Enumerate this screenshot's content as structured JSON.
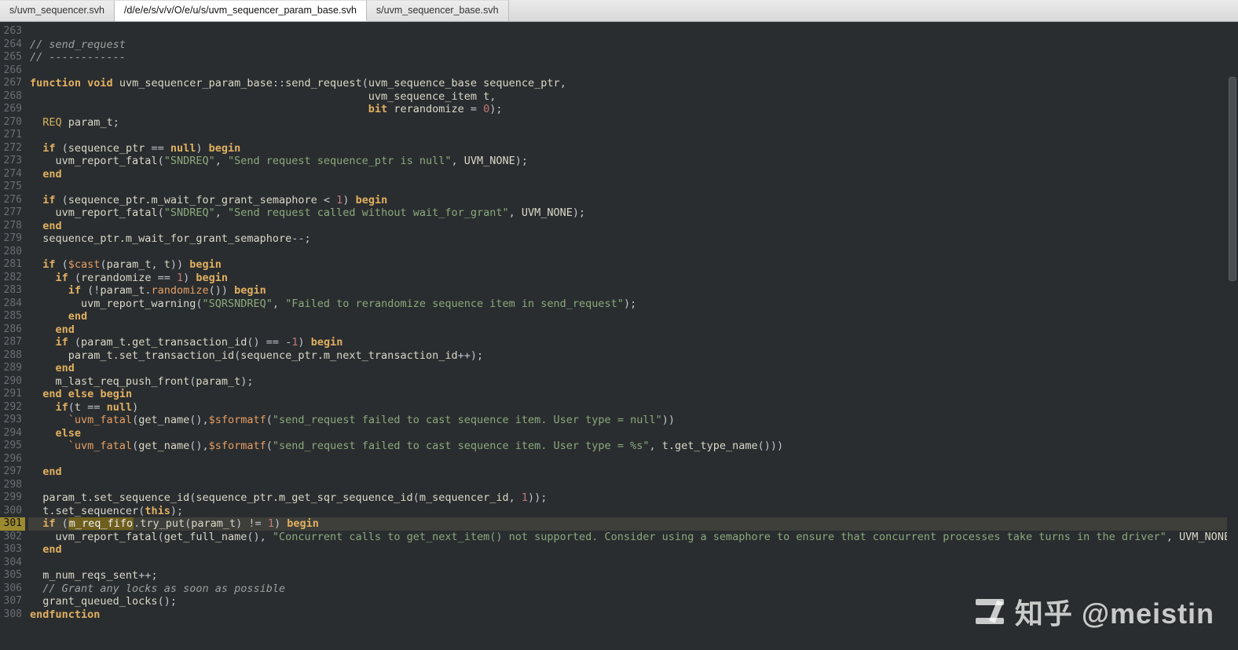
{
  "tabs": [
    {
      "label": "s/uvm_sequencer.svh",
      "active": false
    },
    {
      "label": "/d/e/e/s/v/v/O/e/u/s/uvm_sequencer_param_base.svh",
      "active": true
    },
    {
      "label": "s/uvm_sequencer_base.svh",
      "active": false
    }
  ],
  "first_line_number": 263,
  "highlighted_line": 301,
  "watermark": "知乎 @meistin",
  "lines": [
    {
      "n": 263,
      "t": []
    },
    {
      "n": 264,
      "t": [
        [
          "cm",
          "// send_request"
        ]
      ]
    },
    {
      "n": 265,
      "t": [
        [
          "cm",
          "// ------------"
        ]
      ]
    },
    {
      "n": 266,
      "t": []
    },
    {
      "n": 267,
      "t": [
        [
          "kw",
          "function void"
        ],
        [
          "op",
          " "
        ],
        [
          "fn",
          "uvm_sequencer_param_base"
        ],
        [
          "op",
          "::"
        ],
        [
          "fn",
          "send_request"
        ],
        [
          "op",
          "("
        ],
        [
          "fn",
          "uvm_sequence_base sequence_ptr"
        ],
        [
          "op",
          ","
        ]
      ]
    },
    {
      "n": 268,
      "t": [
        [
          "op",
          "                                                     "
        ],
        [
          "fn",
          "uvm_sequence_item t"
        ],
        [
          "op",
          ","
        ]
      ]
    },
    {
      "n": 269,
      "t": [
        [
          "op",
          "                                                     "
        ],
        [
          "kw",
          "bit"
        ],
        [
          "op",
          " "
        ],
        [
          "fn",
          "rerandomize"
        ],
        [
          "op",
          " = "
        ],
        [
          "nu",
          "0"
        ],
        [
          "op",
          ");"
        ]
      ]
    },
    {
      "n": 270,
      "t": [
        [
          "op",
          "  "
        ],
        [
          "ty",
          "REQ"
        ],
        [
          "op",
          " "
        ],
        [
          "fn",
          "param_t"
        ],
        [
          "op",
          ";"
        ]
      ]
    },
    {
      "n": 271,
      "t": []
    },
    {
      "n": 272,
      "t": [
        [
          "op",
          "  "
        ],
        [
          "kw",
          "if"
        ],
        [
          "op",
          " ("
        ],
        [
          "fn",
          "sequence_ptr"
        ],
        [
          "op",
          " == "
        ],
        [
          "kw",
          "null"
        ],
        [
          "op",
          ") "
        ],
        [
          "kw",
          "begin"
        ]
      ]
    },
    {
      "n": 273,
      "t": [
        [
          "op",
          "    "
        ],
        [
          "fn",
          "uvm_report_fatal"
        ],
        [
          "op",
          "("
        ],
        [
          "st",
          "\"SNDREQ\""
        ],
        [
          "op",
          ", "
        ],
        [
          "st",
          "\"Send request sequence_ptr is null\""
        ],
        [
          "op",
          ", "
        ],
        [
          "fn",
          "UVM_NONE"
        ],
        [
          "op",
          ");"
        ]
      ]
    },
    {
      "n": 274,
      "t": [
        [
          "op",
          "  "
        ],
        [
          "kw",
          "end"
        ]
      ]
    },
    {
      "n": 275,
      "t": []
    },
    {
      "n": 276,
      "t": [
        [
          "op",
          "  "
        ],
        [
          "kw",
          "if"
        ],
        [
          "op",
          " ("
        ],
        [
          "fn",
          "sequence_ptr.m_wait_for_grant_semaphore"
        ],
        [
          "op",
          " < "
        ],
        [
          "nu",
          "1"
        ],
        [
          "op",
          ") "
        ],
        [
          "kw",
          "begin"
        ]
      ]
    },
    {
      "n": 277,
      "t": [
        [
          "op",
          "    "
        ],
        [
          "fn",
          "uvm_report_fatal"
        ],
        [
          "op",
          "("
        ],
        [
          "st",
          "\"SNDREQ\""
        ],
        [
          "op",
          ", "
        ],
        [
          "st",
          "\"Send request called without wait_for_grant\""
        ],
        [
          "op",
          ", "
        ],
        [
          "fn",
          "UVM_NONE"
        ],
        [
          "op",
          ");"
        ]
      ]
    },
    {
      "n": 278,
      "t": [
        [
          "op",
          "  "
        ],
        [
          "kw",
          "end"
        ]
      ]
    },
    {
      "n": 279,
      "t": [
        [
          "op",
          "  "
        ],
        [
          "fn",
          "sequence_ptr.m_wait_for_grant_semaphore"
        ],
        [
          "op",
          "--;"
        ]
      ]
    },
    {
      "n": 280,
      "t": []
    },
    {
      "n": 281,
      "t": [
        [
          "op",
          "  "
        ],
        [
          "kw",
          "if"
        ],
        [
          "op",
          " ("
        ],
        [
          "mc",
          "$cast"
        ],
        [
          "op",
          "("
        ],
        [
          "fn",
          "param_t"
        ],
        [
          "op",
          ", "
        ],
        [
          "fn",
          "t"
        ],
        [
          "op",
          ")) "
        ],
        [
          "kw",
          "begin"
        ]
      ]
    },
    {
      "n": 282,
      "t": [
        [
          "op",
          "    "
        ],
        [
          "kw",
          "if"
        ],
        [
          "op",
          " ("
        ],
        [
          "fn",
          "rerandomize"
        ],
        [
          "op",
          " == "
        ],
        [
          "nu",
          "1"
        ],
        [
          "op",
          ") "
        ],
        [
          "kw",
          "begin"
        ]
      ]
    },
    {
      "n": 283,
      "t": [
        [
          "op",
          "      "
        ],
        [
          "kw",
          "if"
        ],
        [
          "op",
          " (!"
        ],
        [
          "fn",
          "param_t"
        ],
        [
          "op",
          "."
        ],
        [
          "mc",
          "randomize"
        ],
        [
          "op",
          "()) "
        ],
        [
          "kw",
          "begin"
        ]
      ]
    },
    {
      "n": 284,
      "t": [
        [
          "op",
          "        "
        ],
        [
          "fn",
          "uvm_report_warning"
        ],
        [
          "op",
          "("
        ],
        [
          "st",
          "\"SQRSNDREQ\""
        ],
        [
          "op",
          ", "
        ],
        [
          "st",
          "\"Failed to rerandomize sequence item in send_request\""
        ],
        [
          "op",
          ");"
        ]
      ]
    },
    {
      "n": 285,
      "t": [
        [
          "op",
          "      "
        ],
        [
          "kw",
          "end"
        ]
      ]
    },
    {
      "n": 286,
      "t": [
        [
          "op",
          "    "
        ],
        [
          "kw",
          "end"
        ]
      ]
    },
    {
      "n": 287,
      "t": [
        [
          "op",
          "    "
        ],
        [
          "kw",
          "if"
        ],
        [
          "op",
          " ("
        ],
        [
          "fn",
          "param_t.get_transaction_id"
        ],
        [
          "op",
          "() == -"
        ],
        [
          "nu",
          "1"
        ],
        [
          "op",
          ") "
        ],
        [
          "kw",
          "begin"
        ]
      ]
    },
    {
      "n": 288,
      "t": [
        [
          "op",
          "      "
        ],
        [
          "fn",
          "param_t.set_transaction_id"
        ],
        [
          "op",
          "("
        ],
        [
          "fn",
          "sequence_ptr.m_next_transaction_id"
        ],
        [
          "op",
          "++);"
        ]
      ]
    },
    {
      "n": 289,
      "t": [
        [
          "op",
          "    "
        ],
        [
          "kw",
          "end"
        ]
      ]
    },
    {
      "n": 290,
      "t": [
        [
          "op",
          "    "
        ],
        [
          "fn",
          "m_last_req_push_front"
        ],
        [
          "op",
          "("
        ],
        [
          "fn",
          "param_t"
        ],
        [
          "op",
          ");"
        ]
      ]
    },
    {
      "n": 291,
      "t": [
        [
          "op",
          "  "
        ],
        [
          "kw",
          "end"
        ],
        [
          "op",
          " "
        ],
        [
          "kw",
          "else"
        ],
        [
          "op",
          " "
        ],
        [
          "kw",
          "begin"
        ]
      ]
    },
    {
      "n": 292,
      "t": [
        [
          "op",
          "    "
        ],
        [
          "kw",
          "if"
        ],
        [
          "op",
          "("
        ],
        [
          "fn",
          "t"
        ],
        [
          "op",
          " == "
        ],
        [
          "kw",
          "null"
        ],
        [
          "op",
          ")"
        ]
      ]
    },
    {
      "n": 293,
      "t": [
        [
          "op",
          "      "
        ],
        [
          "mc",
          "`uvm_fatal"
        ],
        [
          "op",
          "("
        ],
        [
          "fn",
          "get_name"
        ],
        [
          "op",
          "(),"
        ],
        [
          "mc",
          "$sformatf"
        ],
        [
          "op",
          "("
        ],
        [
          "st",
          "\"send_request failed to cast sequence item. User type = null\""
        ],
        [
          "op",
          "))"
        ]
      ]
    },
    {
      "n": 294,
      "t": [
        [
          "op",
          "    "
        ],
        [
          "kw",
          "else"
        ]
      ]
    },
    {
      "n": 295,
      "t": [
        [
          "op",
          "      "
        ],
        [
          "mc",
          "`uvm_fatal"
        ],
        [
          "op",
          "("
        ],
        [
          "fn",
          "get_name"
        ],
        [
          "op",
          "(),"
        ],
        [
          "mc",
          "$sformatf"
        ],
        [
          "op",
          "("
        ],
        [
          "st",
          "\"send_request failed to cast sequence item. User type = %s\""
        ],
        [
          "op",
          ", "
        ],
        [
          "fn",
          "t.get_type_name"
        ],
        [
          "op",
          "()))"
        ]
      ]
    },
    {
      "n": 296,
      "t": []
    },
    {
      "n": 297,
      "t": [
        [
          "op",
          "  "
        ],
        [
          "kw",
          "end"
        ]
      ]
    },
    {
      "n": 298,
      "t": []
    },
    {
      "n": 299,
      "t": [
        [
          "op",
          "  "
        ],
        [
          "fn",
          "param_t.set_sequence_id"
        ],
        [
          "op",
          "("
        ],
        [
          "fn",
          "sequence_ptr.m_get_sqr_sequence_id"
        ],
        [
          "op",
          "("
        ],
        [
          "fn",
          "m_sequencer_id"
        ],
        [
          "op",
          ", "
        ],
        [
          "nu",
          "1"
        ],
        [
          "op",
          "));"
        ]
      ]
    },
    {
      "n": 300,
      "t": [
        [
          "op",
          "  "
        ],
        [
          "fn",
          "t.set_sequencer"
        ],
        [
          "op",
          "("
        ],
        [
          "kw",
          "this"
        ],
        [
          "op",
          ");"
        ]
      ]
    },
    {
      "n": 301,
      "t": [
        [
          "op",
          "  "
        ],
        [
          "kw",
          "if"
        ],
        [
          "op",
          " ("
        ],
        [
          "hlword",
          "m_req_fifo"
        ],
        [
          "op",
          "."
        ],
        [
          "fn",
          "try_put"
        ],
        [
          "op",
          "("
        ],
        [
          "fn",
          "param_t"
        ],
        [
          "op",
          ") != "
        ],
        [
          "nu",
          "1"
        ],
        [
          "op",
          ") "
        ],
        [
          "kw",
          "begin"
        ]
      ]
    },
    {
      "n": 302,
      "t": [
        [
          "op",
          "    "
        ],
        [
          "fn",
          "uvm_report_fatal"
        ],
        [
          "op",
          "("
        ],
        [
          "fn",
          "get_full_name"
        ],
        [
          "op",
          "(), "
        ],
        [
          "st",
          "\"Concurrent calls to get_next_item() not supported. Consider using a semaphore to ensure that concurrent processes take turns in the driver\""
        ],
        [
          "op",
          ", "
        ],
        [
          "fn",
          "UVM_NONE"
        ],
        [
          "op",
          ");"
        ]
      ]
    },
    {
      "n": 303,
      "t": [
        [
          "op",
          "  "
        ],
        [
          "kw",
          "end"
        ]
      ]
    },
    {
      "n": 304,
      "t": []
    },
    {
      "n": 305,
      "t": [
        [
          "op",
          "  "
        ],
        [
          "fn",
          "m_num_reqs_sent"
        ],
        [
          "op",
          "++;"
        ]
      ]
    },
    {
      "n": 306,
      "t": [
        [
          "op",
          "  "
        ],
        [
          "cm",
          "// Grant any locks as soon as possible"
        ]
      ]
    },
    {
      "n": 307,
      "t": [
        [
          "op",
          "  "
        ],
        [
          "fn",
          "grant_queued_locks"
        ],
        [
          "op",
          "();"
        ]
      ]
    },
    {
      "n": 308,
      "t": [
        [
          "kw",
          "endfunction"
        ]
      ]
    }
  ]
}
